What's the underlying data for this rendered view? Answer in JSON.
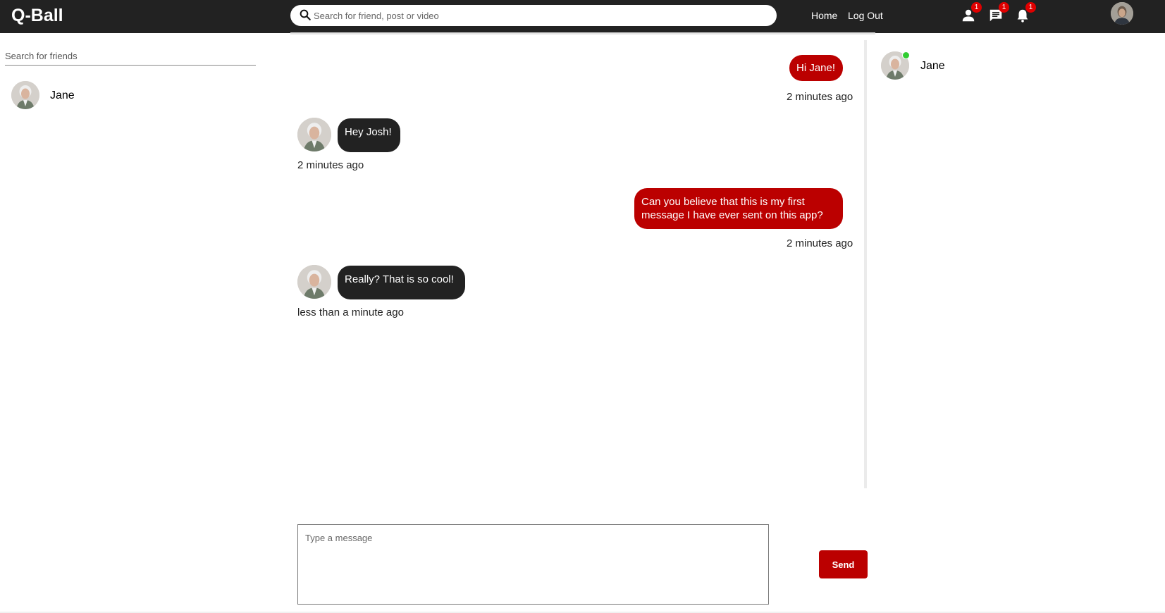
{
  "app": {
    "logo": "Q-Ball"
  },
  "header": {
    "search_placeholder": "Search for friend, post or video",
    "nav": {
      "home": "Home",
      "logout": "Log Out"
    },
    "icons": [
      {
        "name": "friend-requests-icon",
        "badge": "1"
      },
      {
        "name": "messages-icon",
        "badge": "1"
      },
      {
        "name": "notifications-icon",
        "badge": "1"
      }
    ]
  },
  "sidebar": {
    "search_placeholder": "Search for friends",
    "friends": [
      {
        "name": "Jane"
      }
    ]
  },
  "chat": {
    "messages": [
      {
        "own": true,
        "text": "Hi Jane!",
        "time": "2 minutes ago"
      },
      {
        "own": false,
        "text": "Hey Josh!",
        "time": "2 minutes ago"
      },
      {
        "own": true,
        "text": "Can you believe that this is my first message I have ever sent on this app?",
        "time": "2 minutes ago"
      },
      {
        "own": false,
        "text": "Really? That is so cool!",
        "time": "less than a minute ago"
      }
    ],
    "composer_placeholder": "Type a message",
    "send_label": "Send"
  },
  "online": {
    "friends": [
      {
        "name": "Jane",
        "status": "online"
      }
    ]
  },
  "colors": {
    "topbar": "#222222",
    "accent": "#bb0000",
    "incoming_bubble": "#222222",
    "online": "#32cd32",
    "badge": "#e00000"
  }
}
